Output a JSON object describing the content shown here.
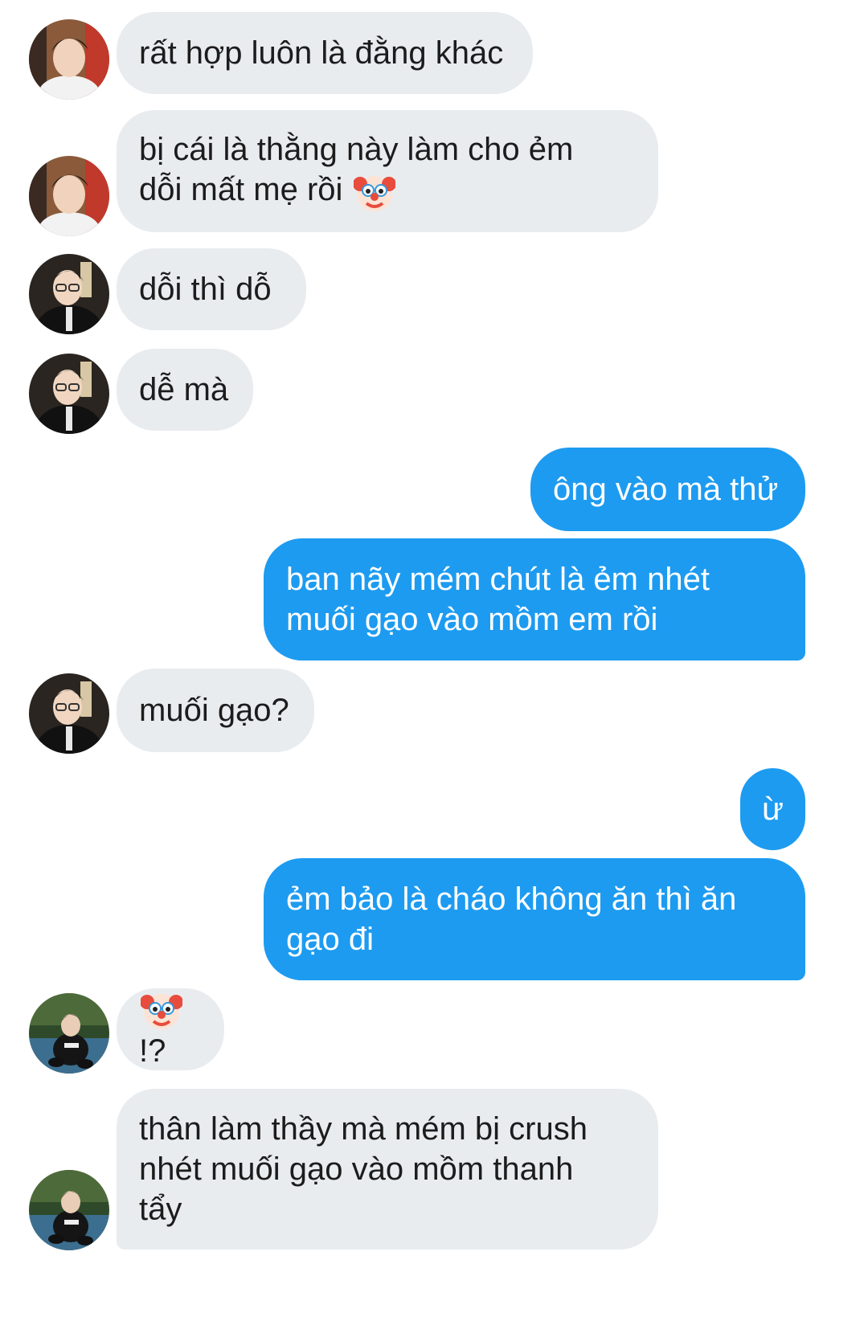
{
  "conversation": {
    "messages": [
      {
        "sender": "guy-light",
        "text": "rất hợp luôn là đằng khác"
      },
      {
        "sender": "guy-light",
        "text_before": "bị cái là thằng này làm cho ẻm\ndỗi mất mẹ rồi ",
        "emoji": "clown-face"
      },
      {
        "sender": "guy-suit",
        "text": "dỗi thì dỗ"
      },
      {
        "sender": "guy-suit",
        "text": "dễ mà"
      },
      {
        "sender": "me",
        "text": "ông vào mà thử"
      },
      {
        "sender": "me",
        "text": "ban nãy mém chút là ẻm nhét\nmuối gạo vào mồm em rồi"
      },
      {
        "sender": "guy-suit",
        "text": "muối gạo?"
      },
      {
        "sender": "me",
        "text": "ừ"
      },
      {
        "sender": "me",
        "text": "ẻm bảo là cháo không ăn thì ăn\ngạo đi"
      },
      {
        "sender": "guy-court",
        "emoji": "clown-face",
        "text_after": "!?"
      },
      {
        "sender": "guy-court",
        "text": "thân làm thầy mà mém bị crush\nnhét muối gạo vào mồm thanh\ntẩy"
      }
    ]
  },
  "colors": {
    "incoming_bubble": "#e9ecef",
    "outgoing_bubble": "#1d9bf0",
    "incoming_text": "#1c1c1c",
    "outgoing_text": "#ffffff"
  }
}
